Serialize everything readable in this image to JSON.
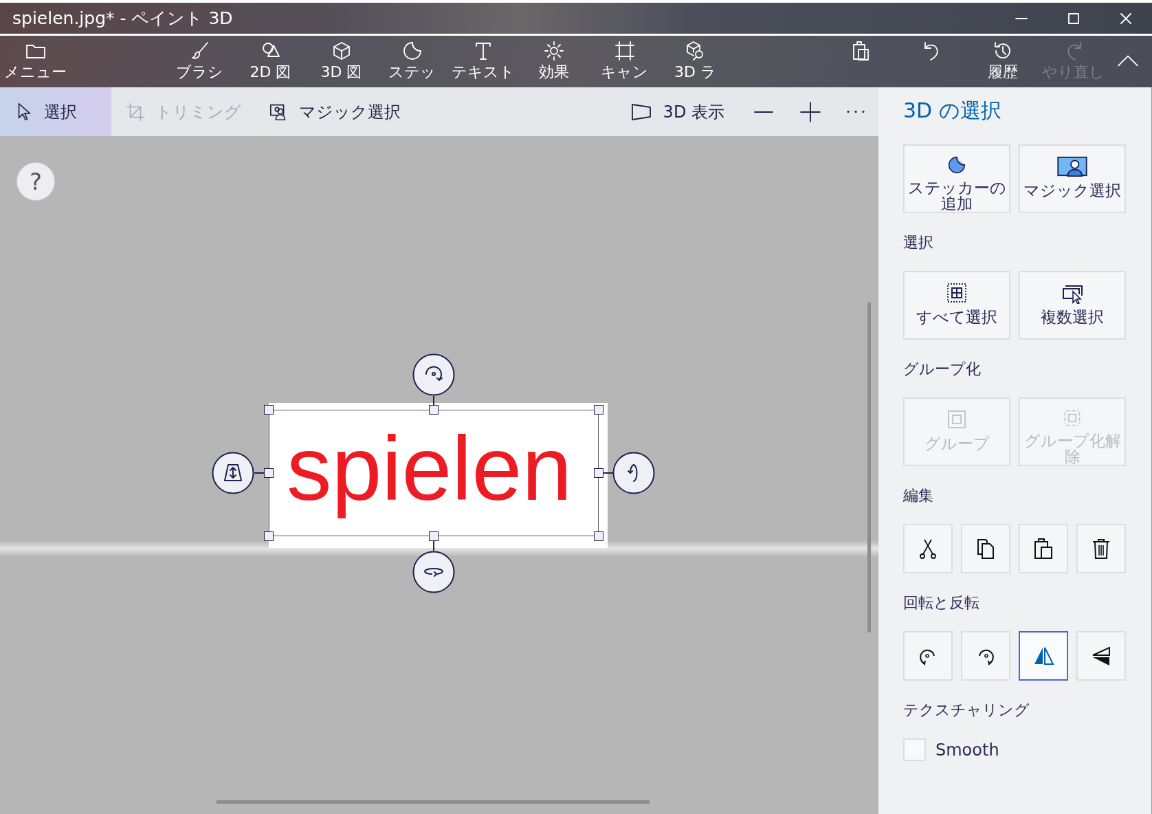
{
  "window": {
    "title": "spielen.jpg* - ペイント 3D"
  },
  "toolbar": {
    "items": [
      {
        "label": "メニュー",
        "disabled": false
      },
      {
        "label": "ブラシ",
        "disabled": false
      },
      {
        "label": "2D 図",
        "disabled": false
      },
      {
        "label": "3D 図",
        "disabled": false
      },
      {
        "label": "ステッ",
        "disabled": false
      },
      {
        "label": "テキスト",
        "disabled": false
      },
      {
        "label": "効果",
        "disabled": false
      },
      {
        "label": "キャン",
        "disabled": false
      },
      {
        "label": "3D ラ",
        "disabled": false
      },
      {
        "disabled": false
      },
      {
        "disabled": false
      },
      {
        "label": "履歴",
        "disabled": false
      },
      {
        "label": "やり直し",
        "disabled": true
      }
    ]
  },
  "subbar": {
    "tools": [
      {
        "label": "選択",
        "selected": true,
        "disabled": false
      },
      {
        "label": "トリミング",
        "selected": false,
        "disabled": true
      },
      {
        "label": "マジック選択",
        "selected": false,
        "disabled": false
      }
    ],
    "view_button": {
      "label": "3D 表示"
    }
  },
  "canvas": {
    "help": "?",
    "object_text": "spielen"
  },
  "panel": {
    "title": "3D の選択",
    "sections": [
      {
        "kind": "labeled",
        "buttons": [
          {
            "label": "ステッカーの追加",
            "disabled": false
          },
          {
            "label": "マジック選択",
            "disabled": false
          }
        ]
      },
      {
        "kind": "labeled",
        "heading": "選択",
        "buttons": [
          {
            "label": "すべて選択",
            "disabled": false
          },
          {
            "label": "複数選択",
            "disabled": false
          }
        ]
      },
      {
        "kind": "labeled",
        "heading": "グループ化",
        "buttons": [
          {
            "label": "グループ",
            "disabled": true
          },
          {
            "label": "グループ化解除",
            "disabled": true
          }
        ]
      },
      {
        "kind": "icons",
        "heading": "編集",
        "buttons": [
          {
            "disabled": false
          },
          {
            "disabled": false
          },
          {
            "disabled": false
          },
          {
            "disabled": false
          }
        ]
      },
      {
        "kind": "icons",
        "heading": "回転と反転",
        "buttons": [
          {
            "selected": false,
            "disabled": false
          },
          {
            "selected": false,
            "disabled": false
          },
          {
            "selected": true,
            "disabled": false
          },
          {
            "selected": false,
            "disabled": false
          }
        ]
      },
      {
        "kind": "checkbox",
        "heading": "テクスチャリング",
        "checkbox": {
          "label": "Smooth",
          "checked": false
        }
      }
    ]
  }
}
